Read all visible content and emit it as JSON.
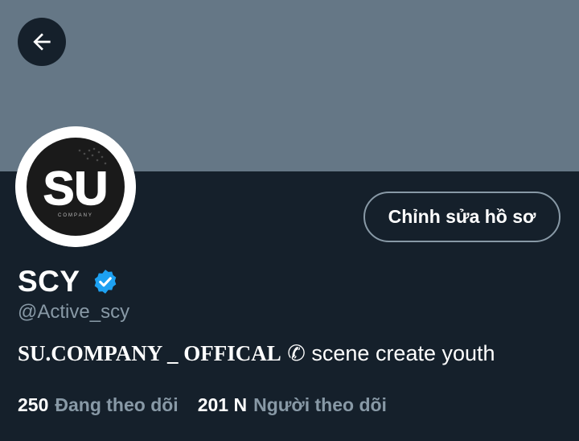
{
  "profile": {
    "display_name": "SCY",
    "handle": "@Active_scy",
    "bio_stylized": "SU.COMPANY _ OFFICAL",
    "bio_symbol": "✆",
    "bio_rest": "scene create youth",
    "edit_profile_label": "Chỉnh sửa hồ sơ",
    "avatar": {
      "logo_text": "SU",
      "sub_text": "COMPANY"
    }
  },
  "stats": {
    "following_count": "250",
    "following_label": "Đang theo dõi",
    "followers_count": "201 N",
    "followers_label": "Người theo dõi"
  },
  "icons": {
    "back": "arrow-left-icon",
    "verified": "verified-badge-icon"
  },
  "colors": {
    "banner": "#657786",
    "background": "#15202b",
    "secondary_text": "#8899a6",
    "verified_blue": "#1da1f2"
  }
}
